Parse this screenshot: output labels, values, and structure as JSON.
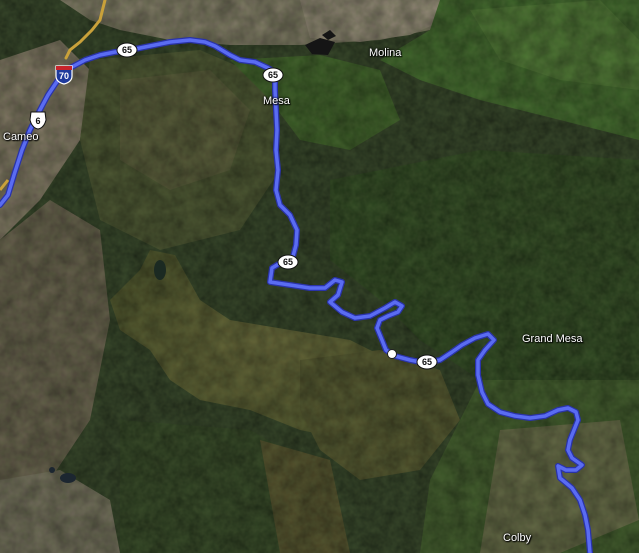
{
  "map": {
    "imagery": "satellite",
    "colors": {
      "route": "#4f5fe8",
      "route_outline": "#2a33a8",
      "secondary_road": "#c9a13a",
      "terrain_dark": "#27361f",
      "terrain_forest": "#3b5a2a",
      "terrain_mesa": "#6a6a3a",
      "terrain_desert": "#8a7f6e"
    }
  },
  "places": {
    "cameo": "Cameo",
    "mesa": "Mesa",
    "molina": "Molina",
    "grand_mesa": "Grand Mesa",
    "colby": "Colby"
  },
  "shields": {
    "interstate": "70",
    "us_route": "6",
    "state_route": "65"
  }
}
